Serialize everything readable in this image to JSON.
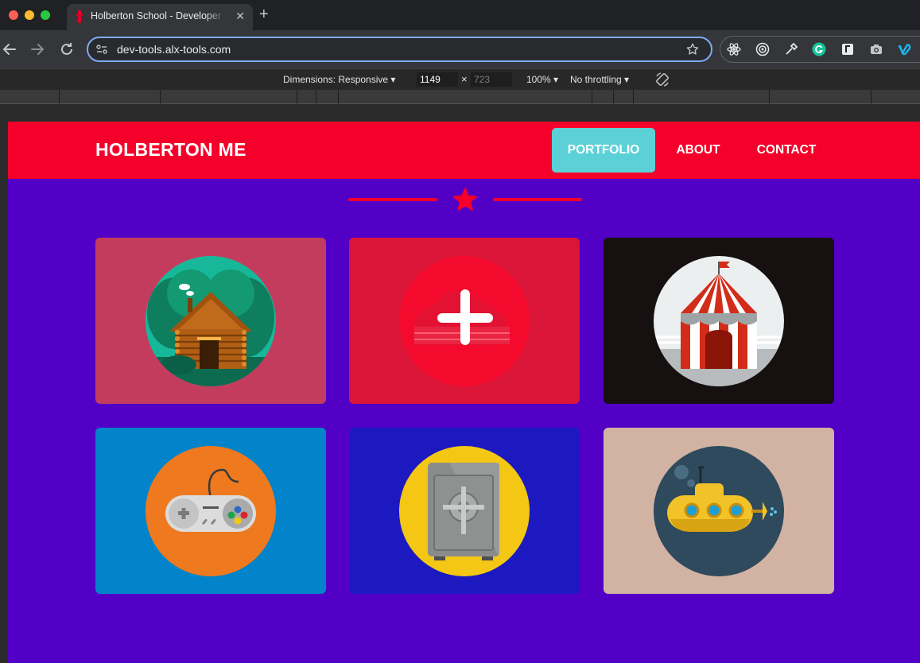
{
  "browser": {
    "tab_title": "Holberton School - Developer Tools",
    "tab_close": "✕",
    "new_tab": "+",
    "url": "dev-tools.alx-tools.com"
  },
  "devtools": {
    "dimensions": "Dimensions: Responsive",
    "width": "1149",
    "times": "×",
    "height": "723",
    "zoom": "100%",
    "throttling": "No throttling"
  },
  "site": {
    "logo": "HOLBERTON ME",
    "nav": [
      "PORTFOLIO",
      "ABOUT",
      "CONTACT"
    ],
    "active_nav": "PORTFOLIO",
    "colors": {
      "header": "#f4002a",
      "background": "#5200c6",
      "active": "#5bd1d7"
    }
  },
  "portfolio": [
    {
      "icon": "cabin-icon",
      "bg": "#c33c5e"
    },
    {
      "icon": "cake-plus-icon",
      "bg": "#db1538"
    },
    {
      "icon": "circus-tent-icon",
      "bg": "#161010"
    },
    {
      "icon": "gamepad-icon",
      "bg": "#0383c9"
    },
    {
      "icon": "safe-icon",
      "bg": "#1c19c0"
    },
    {
      "icon": "submarine-icon",
      "bg": "#d2b2a2"
    }
  ]
}
